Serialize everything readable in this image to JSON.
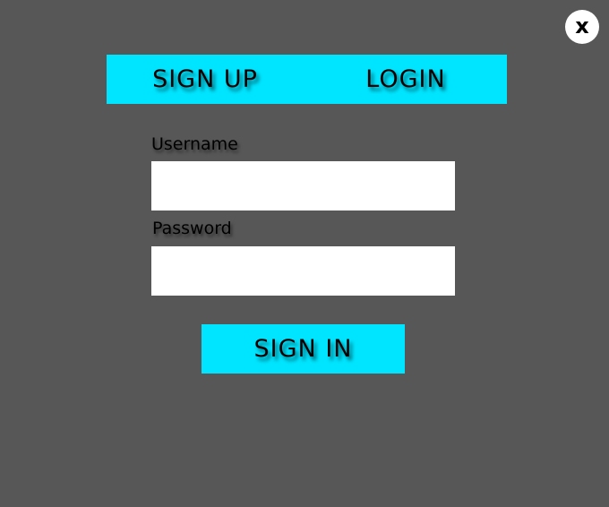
{
  "close": {
    "label": "x",
    "icon": "close-icon"
  },
  "tabs": [
    {
      "label": "SIGN UP"
    },
    {
      "label": "LOGIN"
    }
  ],
  "form": {
    "username": {
      "label": "Username",
      "value": "",
      "placeholder": ""
    },
    "password": {
      "label": "Password",
      "value": "",
      "placeholder": ""
    },
    "submit_label": "SIGN IN"
  },
  "colors": {
    "background": "#575757",
    "accent": "#00e5ff",
    "input_background": "#ffffff",
    "text": "#000000"
  }
}
